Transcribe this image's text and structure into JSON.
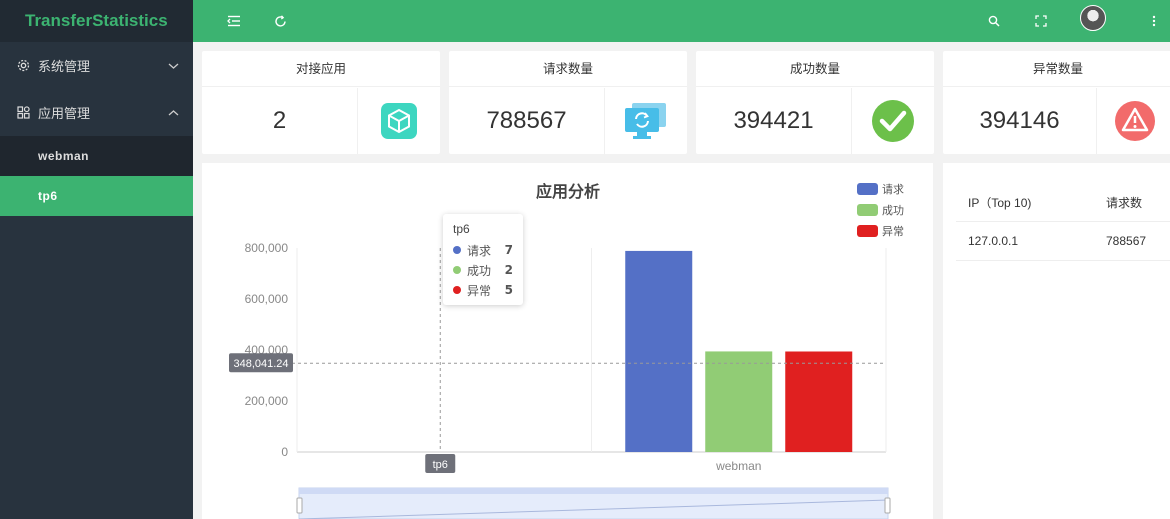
{
  "app": {
    "title": "TransferStatistics"
  },
  "sidebar": {
    "menus": [
      {
        "label": "系统管理",
        "icon": "gear-icon",
        "expanded": false
      },
      {
        "label": "应用管理",
        "icon": "app-grid-icon",
        "expanded": true,
        "children": [
          {
            "label": "webman",
            "active": false
          },
          {
            "label": "tp6",
            "active": true
          }
        ]
      }
    ]
  },
  "header": {
    "icons": [
      "menu-fold-icon",
      "refresh-icon",
      "search-icon",
      "fullscreen-icon",
      "user-avatar",
      "more-vertical-icon"
    ]
  },
  "stats": [
    {
      "title": "对接应用",
      "value": "2",
      "icon": "cube-icon",
      "color": "#3dd6c0"
    },
    {
      "title": "请求数量",
      "value": "788567",
      "icon": "monitor-sync-icon",
      "color": "#47bde8"
    },
    {
      "title": "成功数量",
      "value": "394421",
      "icon": "check-circle-icon",
      "color": "#6cc04a"
    },
    {
      "title": "异常数量",
      "value": "394146",
      "icon": "warning-circle-icon",
      "color": "#f26b6b"
    }
  ],
  "chart_data": {
    "type": "bar",
    "title": "应用分析",
    "categories": [
      "tp6",
      "webman"
    ],
    "series": [
      {
        "name": "请求",
        "values": [
          7,
          788567
        ],
        "color": "#5470c6"
      },
      {
        "name": "成功",
        "values": [
          2,
          394421
        ],
        "color": "#91cc75"
      },
      {
        "name": "异常",
        "values": [
          5,
          394146
        ],
        "color": "#e02020"
      }
    ],
    "ylim": [
      0,
      800000
    ],
    "yticks": [
      "800,000",
      "600,000",
      "400,000",
      "200,000",
      "0"
    ],
    "legend": "top-right",
    "crosshair": {
      "y_value": 348041.24,
      "y_label": "348,041.24",
      "x_label": "tp6"
    }
  },
  "tooltip": {
    "title": "tp6",
    "rows": [
      {
        "name": "请求",
        "value": "7",
        "color": "#5470c6"
      },
      {
        "name": "成功",
        "value": "2",
        "color": "#91cc75"
      },
      {
        "name": "异常",
        "value": "5",
        "color": "#e02020"
      }
    ]
  },
  "ip_table": {
    "headers": [
      "IP（Top 10)",
      "请求数"
    ],
    "rows": [
      [
        "127.0.0.1",
        "788567"
      ]
    ]
  }
}
